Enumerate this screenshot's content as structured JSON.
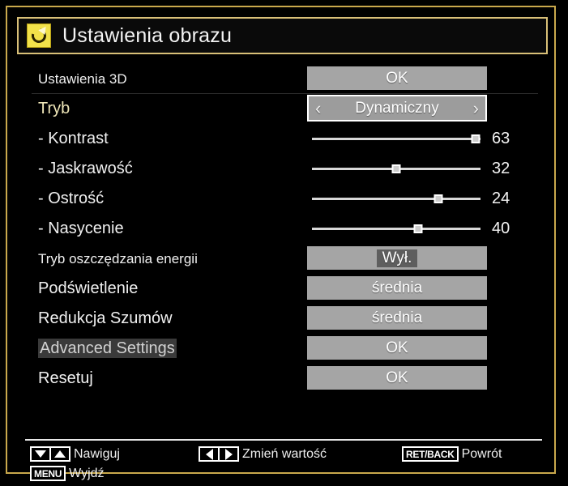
{
  "theme": {
    "background": "#000000",
    "frame_border": "#c9a84c",
    "title_border": "#d9c078",
    "icon_bg": "#f2e24a",
    "value_box_bg": "#a5a5a5",
    "selected_label": "#efe6b8",
    "text": "#f0f0f0"
  },
  "title": {
    "text": "Ustawienia obrazu",
    "icon": "picture-settings-icon"
  },
  "rows": [
    {
      "label": "Ustawienia 3D",
      "type": "action",
      "value": "OK",
      "selected": false,
      "label_style": "small"
    },
    {
      "label": "Tryb",
      "type": "spinner",
      "value": "Dynamiczny",
      "selected": true,
      "label_style": "normal",
      "arrow_left": "‹",
      "arrow_right": "›"
    },
    {
      "label": "- Kontrast",
      "type": "slider",
      "value": "63",
      "selected": false,
      "label_style": "normal",
      "percent": 97
    },
    {
      "label": "- Jaskrawość",
      "type": "slider",
      "value": "32",
      "selected": false,
      "label_style": "normal",
      "percent": 50
    },
    {
      "label": "- Ostrość",
      "type": "slider",
      "value": "24",
      "selected": false,
      "label_style": "normal",
      "percent": 75
    },
    {
      "label": "- Nasycenie",
      "type": "slider",
      "value": "40",
      "selected": false,
      "label_style": "normal",
      "percent": 63
    },
    {
      "label": "Tryb oszczędzania energii",
      "type": "option",
      "value": "Wył.",
      "selected": false,
      "label_style": "small",
      "value_inset": true
    },
    {
      "label": "Podświetlenie",
      "type": "option",
      "value": "średnia",
      "selected": false,
      "label_style": "normal"
    },
    {
      "label": "Redukcja Szumów",
      "type": "option",
      "value": "średnia",
      "selected": false,
      "label_style": "normal"
    },
    {
      "label": "Advanced Settings",
      "type": "action",
      "value": "OK",
      "selected": false,
      "label_style": "dim",
      "label_highlight": true
    },
    {
      "label": "Resetuj",
      "type": "action",
      "value": "OK",
      "selected": false,
      "label_style": "normal"
    }
  ],
  "footer": {
    "navigate": {
      "label": "Nawiguj",
      "keys": [
        "arrow-down-key",
        "arrow-up-key"
      ]
    },
    "change": {
      "label": "Zmień wartość",
      "keys": [
        "arrow-left-key",
        "arrow-right-key"
      ]
    },
    "back": {
      "label": "Powrót",
      "keycap": "RET/BACK"
    },
    "exit": {
      "label": "Wyjdź",
      "keycap": "MENU"
    }
  }
}
